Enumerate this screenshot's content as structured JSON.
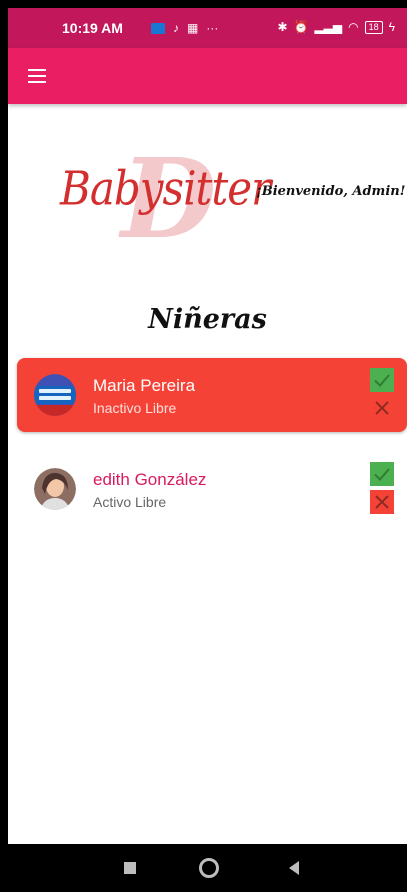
{
  "status_bar": {
    "time": "10:19 AM",
    "battery": "18",
    "more": "···"
  },
  "app_bar": {
    "menu_icon": "hamburger-menu-icon"
  },
  "header": {
    "logo_text": "Babysitter",
    "logo_letter": "D",
    "welcome": "¡Bienvenido, Admin!"
  },
  "section_title": "Niñeras",
  "babysitters": [
    {
      "name": "Maria Pereira",
      "status": "Inactivo",
      "availability": "Libre",
      "selected": true
    },
    {
      "name": "edith González",
      "status": "Activo",
      "availability": "Libre",
      "selected": false
    }
  ],
  "colors": {
    "status_bar": "#c2185b",
    "app_bar": "#e91e63",
    "selected_card": "#f44336",
    "approve": "#4caf50",
    "reject": "#f44336",
    "name_accent": "#d81b60"
  },
  "nav": {
    "recent_icon": "square-icon",
    "home_icon": "circle-icon",
    "back_icon": "back-triangle-icon"
  }
}
